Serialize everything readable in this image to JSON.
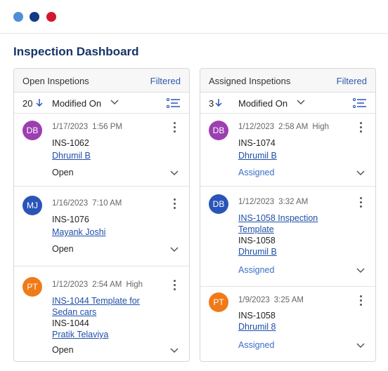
{
  "window": {
    "controls": [
      {
        "name": "minimize",
        "color": "#4d8fd6"
      },
      {
        "name": "maximize",
        "color": "#133a85"
      },
      {
        "name": "close",
        "color": "#d4172d"
      }
    ]
  },
  "page": {
    "title": "Inspection Dashboard"
  },
  "colors": {
    "title": "#16336a",
    "link": "#1f4fa8",
    "filter": "#2f5aa8",
    "status_assigned": "#3a6fc6"
  },
  "panels": [
    {
      "title": "Open Inspetions",
      "filter_label": "Filtered",
      "count": "20",
      "sort_direction": "descending",
      "sort_label": "Modified On",
      "cards": [
        {
          "initials": "DB",
          "avatar_color": "#9c3fb0",
          "date": "1/17/2023",
          "time": "1:56 PM",
          "priority": "",
          "id": "INS-1062",
          "link_lines": [],
          "number": "",
          "assignee": "Dhrumil B",
          "status": "Open"
        },
        {
          "initials": "MJ",
          "avatar_color": "#2a55b8",
          "date": "1/16/2023",
          "time": "7:10 AM",
          "priority": "",
          "id": "INS-1076",
          "link_lines": [],
          "number": "",
          "assignee": "Mayank Joshi",
          "status": "Open"
        },
        {
          "initials": "PT",
          "avatar_color": "#f07a18",
          "date": "1/12/2023",
          "time": "2:54 AM",
          "priority": "High",
          "id": "",
          "link_lines": [
            "INS-1044 Template for",
            "Sedan cars"
          ],
          "number": "INS-1044",
          "assignee": "Pratik Telaviya",
          "status": "Open"
        }
      ]
    },
    {
      "title": "Assigned Inspetions",
      "filter_label": "Filtered",
      "count": "3",
      "sort_direction": "descending",
      "sort_label": "Modified On",
      "cards": [
        {
          "initials": "DB",
          "avatar_color": "#9c3fb0",
          "date": "1/12/2023",
          "time": "2:58 AM",
          "priority": "High",
          "id": "INS-1074",
          "link_lines": [],
          "number": "",
          "assignee": "Dhrumil B",
          "status": "Assigned"
        },
        {
          "initials": "DB",
          "avatar_color": "#2a55b8",
          "date": "1/12/2023",
          "time": "3:32 AM",
          "priority": "",
          "id": "",
          "link_lines": [
            "INS-1058 Inspection",
            "Template"
          ],
          "number": "INS-1058",
          "assignee": "Dhrumil B",
          "status": "Assigned"
        },
        {
          "initials": "PT",
          "avatar_color": "#f07a18",
          "date": "1/9/2023",
          "time": "3:25 AM",
          "priority": "",
          "id": "INS-1058",
          "link_lines": [],
          "number": "",
          "assignee": "Dhrumil 8",
          "status": "Assigned"
        }
      ]
    }
  ]
}
